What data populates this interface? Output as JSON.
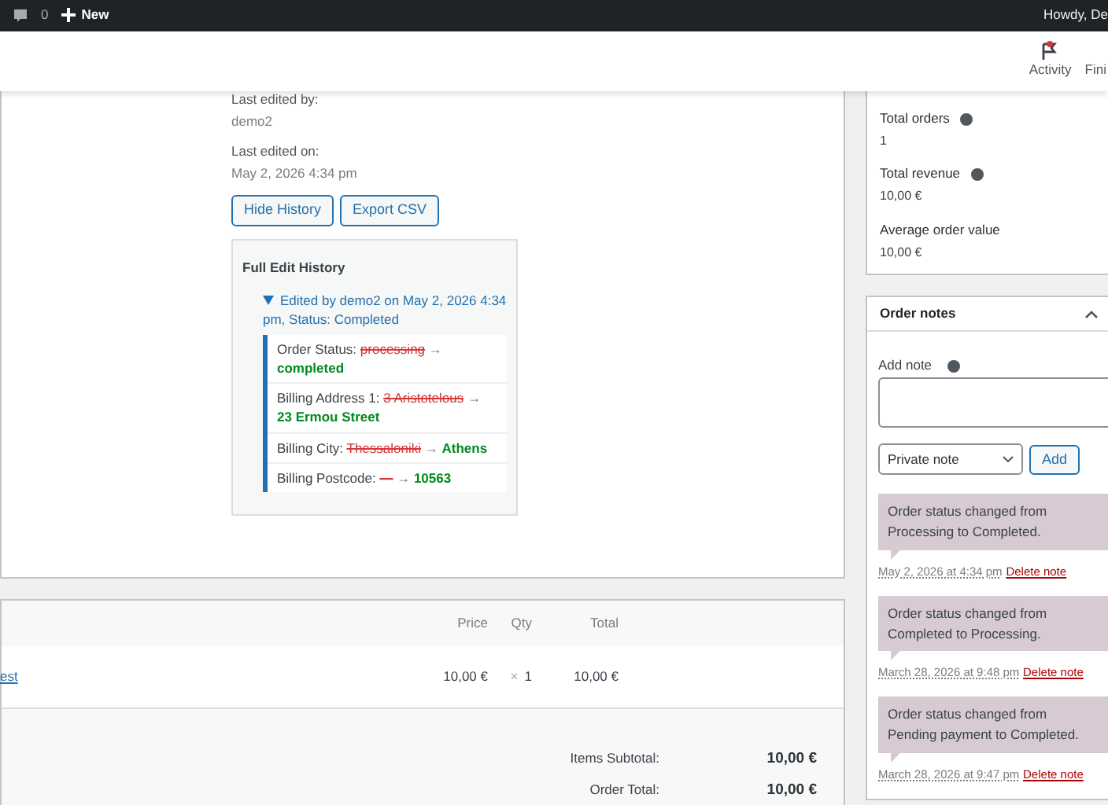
{
  "admin_bar": {
    "comments_count": "0",
    "new_label": "New",
    "greeting": "Howdy, De"
  },
  "header": {
    "tabs": [
      {
        "label": "Activity"
      },
      {
        "label": "Fini"
      }
    ]
  },
  "edit_info": {
    "fields": [
      {
        "label": "Last edited by:",
        "value": "demo2"
      },
      {
        "label": "Last edited on:",
        "value": "May 2, 2026 4:34 pm"
      }
    ],
    "buttons": [
      "Hide History",
      "Export CSV"
    ]
  },
  "history": {
    "title": "Full Edit History",
    "entries": [
      {
        "summary": "Edited by demo2 on May 2, 2026 4:34 pm, Status: Completed",
        "expanded": true,
        "changes": [
          {
            "field": "Order Status:",
            "old": "processing",
            "arrow": "→",
            "new": "completed"
          },
          {
            "field": "Billing Address 1:",
            "old": "3 Aristotelous",
            "arrow": "→",
            "new": "23 Ermou Street"
          },
          {
            "field": "Billing City:",
            "old": "Thessaloniki",
            "arrow": "→",
            "new": "Athens"
          },
          {
            "field": "Billing Postcode:",
            "old": "—",
            "arrow": "→",
            "new": "10563"
          }
        ]
      }
    ]
  },
  "items": {
    "columns": [
      "Price",
      "Qty",
      "Total"
    ],
    "rows": [
      {
        "name": "est",
        "price": "10,00 €",
        "qty_sign": "×",
        "qty": "1",
        "total": "10,00 €"
      }
    ],
    "totals": [
      {
        "label": "Items Subtotal:",
        "value": "10,00 €"
      },
      {
        "label": "Order Total:",
        "value": "10,00 €"
      }
    ]
  },
  "customer_stats": [
    {
      "label": "Total orders",
      "help": true,
      "value": "1"
    },
    {
      "label": "Total revenue",
      "help": true,
      "value": "10,00 €"
    },
    {
      "label": "Average order value",
      "help": false,
      "value": "10,00 €"
    }
  ],
  "order_notes": {
    "title": "Order notes",
    "add_label": "Add note",
    "note_type": "Private note",
    "add_button": "Add",
    "notes": [
      {
        "text": "Order status changed from Processing to Completed.",
        "date": "May 2, 2026 at 4:34 pm",
        "delete": "Delete note"
      },
      {
        "text": "Order status changed from Completed to Processing.",
        "date": "March 28, 2026 at 9:48 pm",
        "delete": "Delete note"
      },
      {
        "text": "Order status changed from Pending payment to Completed.",
        "date": "March 28, 2026 at 9:47 pm",
        "delete": "Delete note"
      }
    ]
  }
}
